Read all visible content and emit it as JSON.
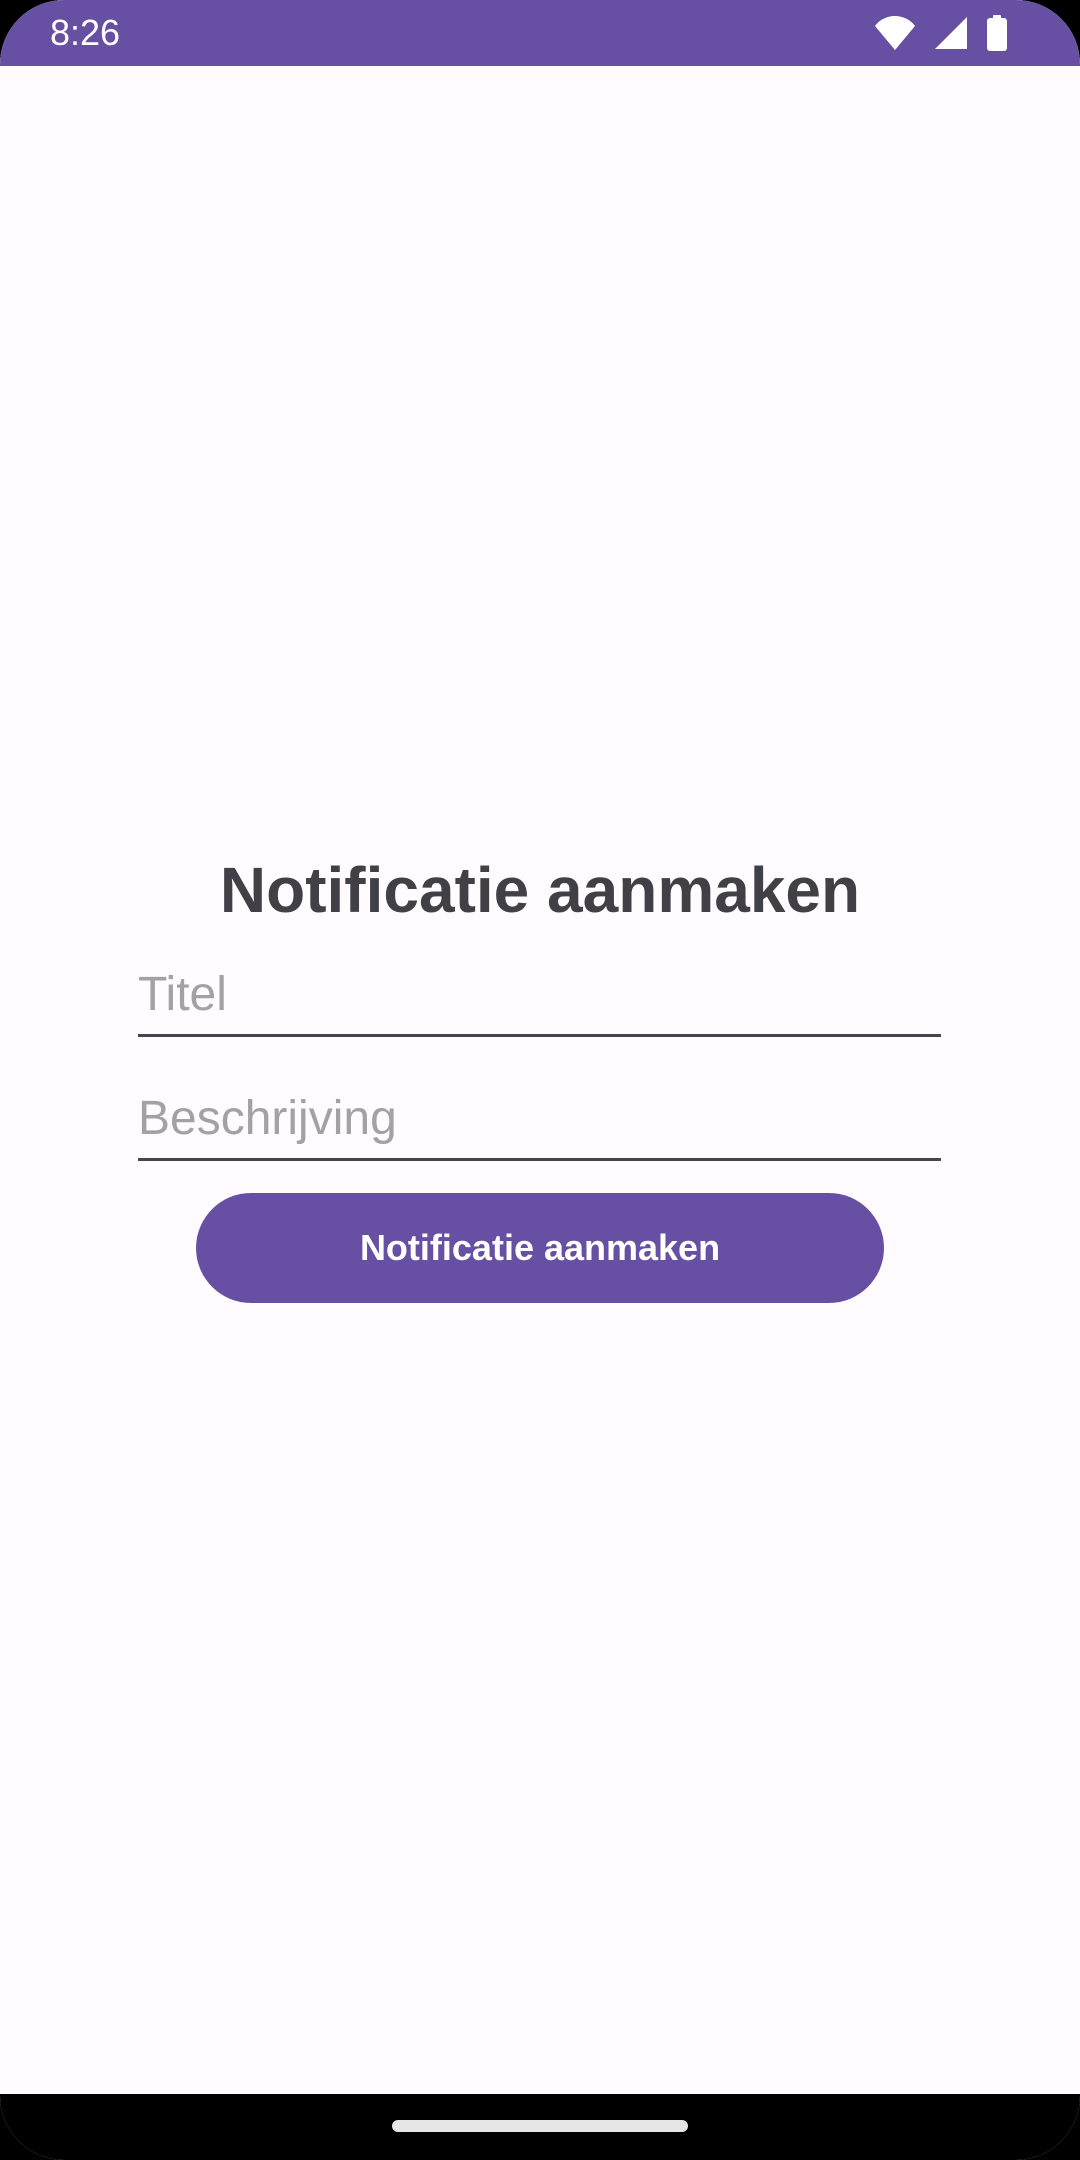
{
  "status_bar": {
    "time": "8:26",
    "background": "#6750A4",
    "icons": [
      "wifi-icon",
      "cell-signal-icon",
      "battery-icon"
    ]
  },
  "form": {
    "title": "Notificatie aanmaken",
    "title_input": {
      "placeholder": "Titel",
      "value": ""
    },
    "description_input": {
      "placeholder": "Beschrijving",
      "value": ""
    },
    "submit_label": "Notificatie aanmaken"
  },
  "colors": {
    "accent": "#6750A4",
    "background": "#FFFBFE",
    "title_text": "#424047",
    "placeholder_text": "#A3A1A6"
  }
}
